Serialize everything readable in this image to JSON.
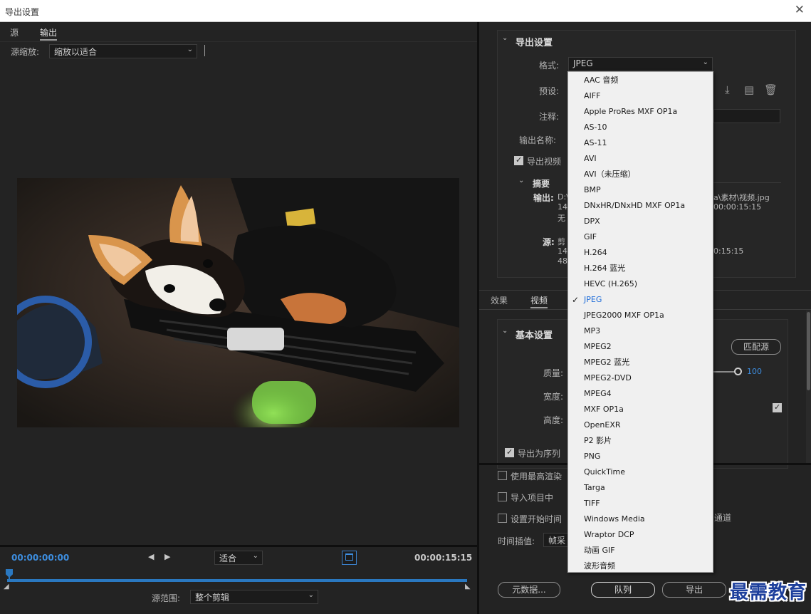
{
  "window": {
    "title": "导出设置",
    "close_glyph": "✕"
  },
  "left": {
    "tabs": [
      {
        "label": "源"
      },
      {
        "label": "输出"
      }
    ],
    "source_zoom": {
      "label": "源缩放:",
      "value": "缩放以适合"
    },
    "preview_image": "corgi-puppy-video-frame",
    "timeline": {
      "timecode_start": "00:00:00:00",
      "timecode_end": "00:00:15:15",
      "fit_value": "适合",
      "playhead_position": 0.0,
      "range_label": "源范围:",
      "range_value": "整个剪辑"
    }
  },
  "right": {
    "export_settings": {
      "header": "导出设置",
      "format_label": "格式:",
      "format_value": "JPEG",
      "preset_label": "预设:",
      "comment_label": "注释:",
      "output_name_label": "输出名称:",
      "export_video_label": "导出视频",
      "export_video_checked": true,
      "summary": {
        "header": "摘要",
        "output_label": "输出:",
        "output_lines": [
          "D:\\",
          "14",
          "无"
        ],
        "output_right_lines": [
          "a\\素材\\视频.jpg",
          "00:00:15:15"
        ],
        "source_label": "源:",
        "source_first": "剪",
        "source_lines": [
          "14",
          "48"
        ],
        "source_right": "0:15:15"
      }
    },
    "tabs": [
      {
        "label": "效果"
      },
      {
        "label": "视频"
      }
    ],
    "basic_settings": {
      "header": "基本设置",
      "match_source_button": "匹配源",
      "quality_label": "质量:",
      "quality_value": "100",
      "width_label": "宽度:",
      "height_label": "高度:",
      "export_sequence_label": "导出为序列",
      "export_sequence_checked": true,
      "link_checked": true
    },
    "options": {
      "max_render_label": "使用最高渲染",
      "import_project_label": "导入项目中",
      "set_start_time_label": "设置开始时间",
      "channel_label": "通道",
      "time_interp_label": "时间插值:",
      "time_interp_value": "帧采"
    },
    "buttons": {
      "metadata": "元数据...",
      "queue": "队列",
      "export": "导出"
    }
  },
  "format_menu": {
    "selected": "JPEG",
    "items": [
      "AAC 音频",
      "AIFF",
      "Apple ProRes MXF OP1a",
      "AS-10",
      "AS-11",
      "AVI",
      "AVI（未压缩）",
      "BMP",
      "DNxHR/DNxHD MXF OP1a",
      "DPX",
      "GIF",
      "H.264",
      "H.264 蓝光",
      "HEVC (H.265)",
      "JPEG",
      "JPEG2000 MXF OP1a",
      "MP3",
      "MPEG2",
      "MPEG2 蓝光",
      "MPEG2-DVD",
      "MPEG4",
      "MXF OP1a",
      "OpenEXR",
      "P2 影片",
      "PNG",
      "QuickTime",
      "Targa",
      "TIFF",
      "Windows Media",
      "Wraptor DCP",
      "动画 GIF",
      "波形音频"
    ]
  },
  "watermark": "最需教育",
  "colors": {
    "accent": "#3d8ee0",
    "panel": "#232323",
    "menu_bg": "#f0f0f0"
  }
}
